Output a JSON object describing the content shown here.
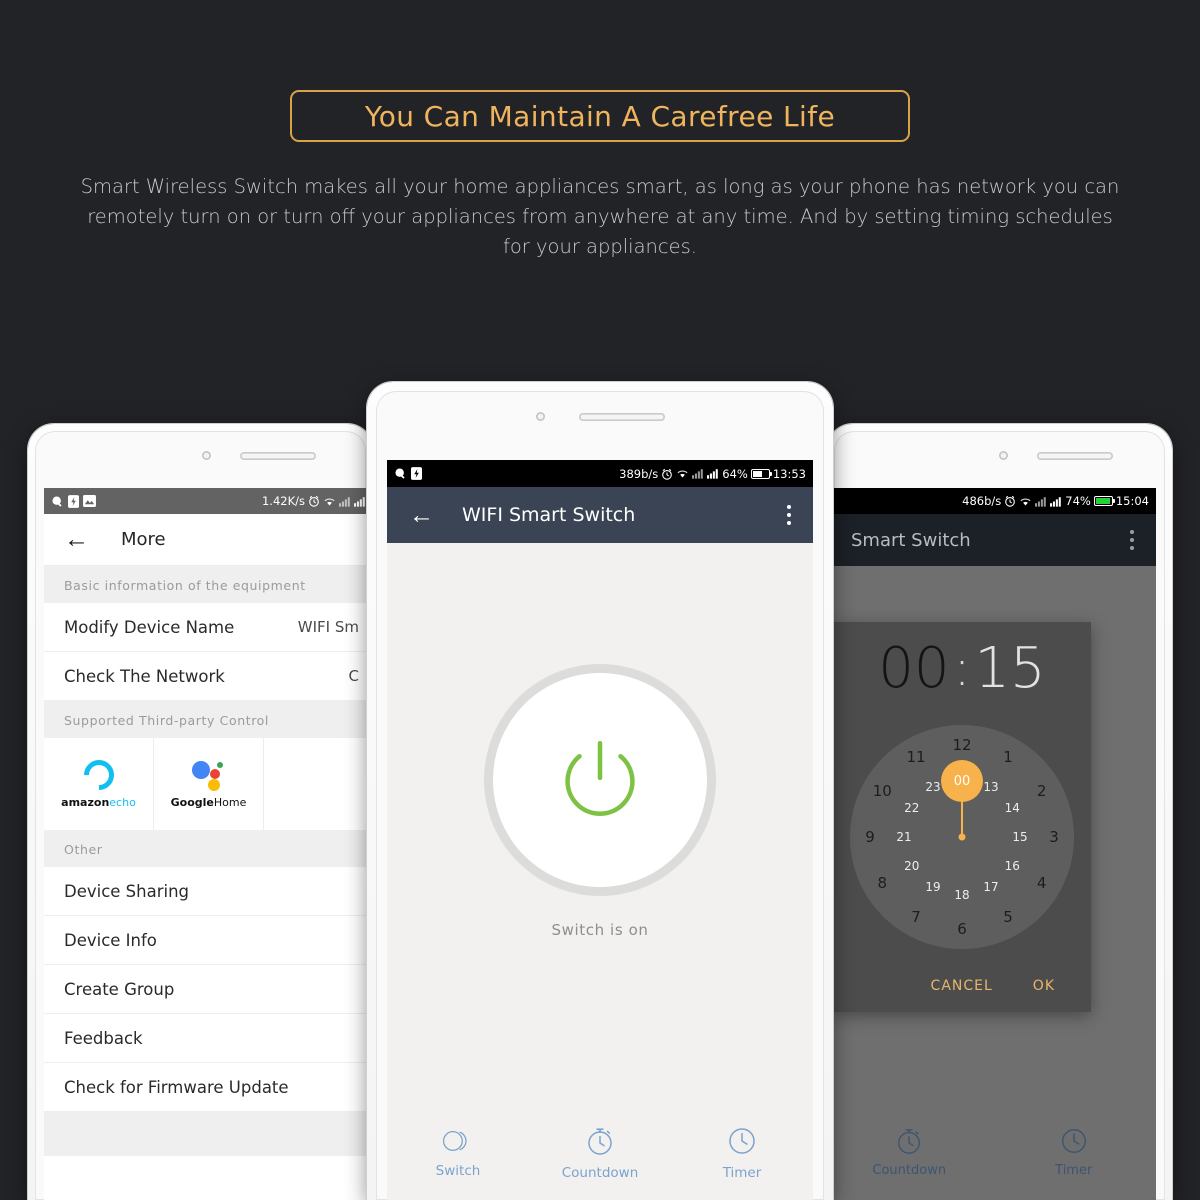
{
  "header": {
    "title": "You Can Maintain A Carefree Life",
    "subtitle": "Smart Wireless Switch makes all your home appliances smart, as long as your phone has network you can remotely turn on or turn off your appliances from anywhere at any time. And by setting timing schedules for your appliances.",
    "accent_color": "#d9a14a",
    "title_color": "#f0b45c",
    "background_color": "#222327"
  },
  "left_phone": {
    "status_bar": {
      "speed": "1.42K/s",
      "icons": [
        "search-icon",
        "lightning-icon",
        "image-icon",
        "alarm-icon",
        "wifi-icon",
        "signal-1-icon",
        "signal-2-icon"
      ]
    },
    "appbar": {
      "back": "←",
      "title": "More"
    },
    "section_basic": "Basic information of the equipment",
    "rows_basic": [
      {
        "label": "Modify Device Name",
        "value": "WIFI Sm"
      },
      {
        "label": "Check The Network",
        "value": "C"
      }
    ],
    "section_third_party": "Supported Third-party Control",
    "third_party": [
      {
        "brand_bold": "amazon",
        "brand_light": "echo",
        "icon": "amazon-echo-icon"
      },
      {
        "brand_bold": "Google",
        "brand_light": "Home",
        "icon": "google-home-icon"
      }
    ],
    "section_other": "Other",
    "rows_other": [
      {
        "label": "Device Sharing"
      },
      {
        "label": "Device Info"
      },
      {
        "label": "Create Group"
      },
      {
        "label": "Feedback"
      },
      {
        "label": "Check for Firmware Update"
      }
    ]
  },
  "center_phone": {
    "status_bar": {
      "speed": "389b/s",
      "battery": "64%",
      "time": "13:53"
    },
    "appbar": {
      "back": "←",
      "title": "WIFI Smart Switch",
      "menu": "kebab-menu-icon"
    },
    "power": {
      "state_label": "Switch is on",
      "icon": "power-icon",
      "color": "#7dc243"
    },
    "tabs": [
      {
        "label": "Switch",
        "icon": "switch-toggle-icon"
      },
      {
        "label": "Countdown",
        "icon": "stopwatch-icon"
      },
      {
        "label": "Timer",
        "icon": "clock-icon"
      }
    ],
    "tab_color": "#7ba3cd"
  },
  "right_phone": {
    "status_bar": {
      "speed": "486b/s",
      "battery": "74%",
      "time": "15:04"
    },
    "appbar": {
      "title": "Smart Switch",
      "menu": "kebab-menu-icon"
    },
    "time_picker": {
      "hours": "00",
      "separator": ":",
      "minutes": "15",
      "selected": "00",
      "outer_ticks": [
        "12",
        "1",
        "2",
        "3",
        "4",
        "5",
        "6",
        "7",
        "8",
        "9",
        "10",
        "11"
      ],
      "inner_ticks": [
        "00",
        "13",
        "14",
        "15",
        "16",
        "17",
        "18",
        "19",
        "20",
        "21",
        "22",
        "23"
      ],
      "cancel_label": "CANCEL",
      "ok_label": "OK",
      "accent_color": "#f7b24b"
    },
    "tabs": [
      {
        "label": "Countdown",
        "icon": "stopwatch-icon"
      },
      {
        "label": "Timer",
        "icon": "clock-icon"
      }
    ]
  }
}
